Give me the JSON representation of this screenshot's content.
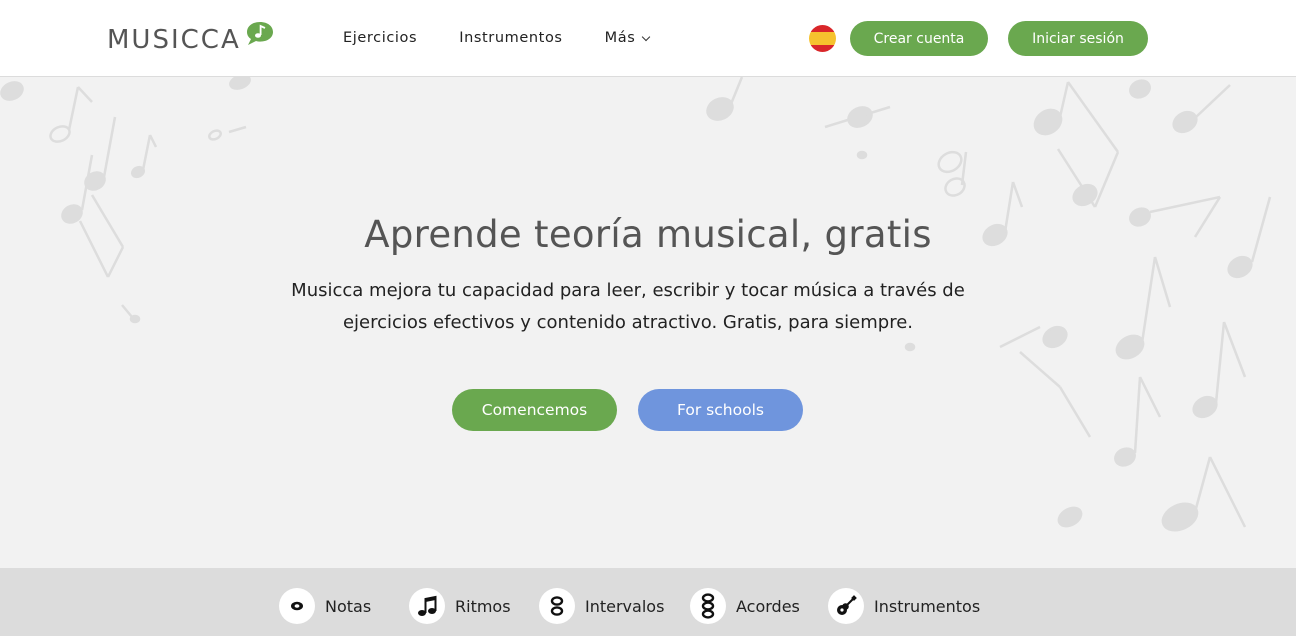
{
  "logo": {
    "text": "MUSICCA",
    "icon": "speech-bubble-note-icon",
    "accent": "#6aa84f"
  },
  "nav": {
    "items": [
      {
        "label": "Ejercicios"
      },
      {
        "label": "Instrumentos"
      },
      {
        "label": "Más"
      }
    ]
  },
  "header": {
    "language_flag": "spain-flag-icon",
    "signup_label": "Crear cuenta",
    "login_label": "Iniciar sesión"
  },
  "hero": {
    "title": "Aprende teoría musical, gratis",
    "subtitle_line1": "Musicca mejora tu capacidad para leer, escribir y tocar música a través de",
    "subtitle_line2": "ejercicios efectivos y contenido atractivo. Gratis, para siempre.",
    "start_label": "Comencemos",
    "schools_label": "For schools"
  },
  "categories": [
    {
      "label": "Notas",
      "icon": "eye-icon"
    },
    {
      "label": "Ritmos",
      "icon": "music-note-icon"
    },
    {
      "label": "Intervalos",
      "icon": "interval-icon"
    },
    {
      "label": "Acordes",
      "icon": "chord-icon"
    },
    {
      "label": "Instrumentos",
      "icon": "guitar-icon"
    }
  ],
  "colors": {
    "green": "#6aa84f",
    "blue": "#6f95dd",
    "bar": "#dcdcdc"
  }
}
